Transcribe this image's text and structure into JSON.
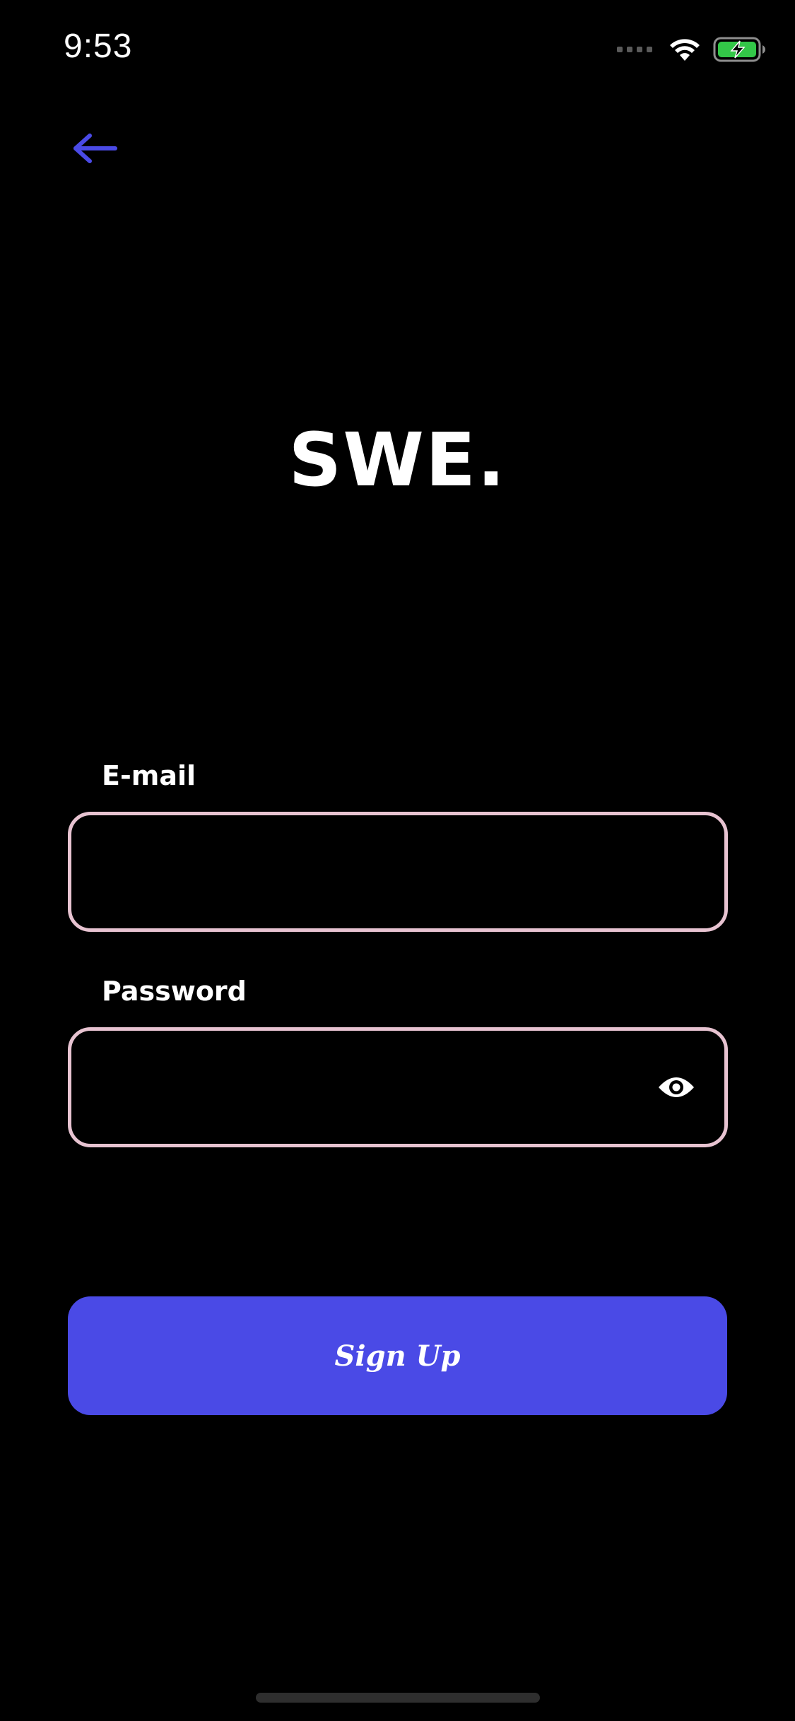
{
  "status_bar": {
    "time": "9:53",
    "icons": [
      "cellular-signal-icon",
      "wifi-icon",
      "battery-charging-icon"
    ]
  },
  "nav": {
    "back_icon": "arrow-left-icon"
  },
  "branding": {
    "logo_text": "SWE."
  },
  "form": {
    "email_label": "E-mail",
    "email_value": "",
    "password_label": "Password",
    "password_value": "",
    "password_toggle_icon": "eye-icon"
  },
  "actions": {
    "signup_label": "Sign Up"
  },
  "colors": {
    "background": "#000000",
    "accent": "#4a4ae6",
    "field_border": "#e7c3d1",
    "battery_fill": "#33c748",
    "text": "#ffffff"
  }
}
